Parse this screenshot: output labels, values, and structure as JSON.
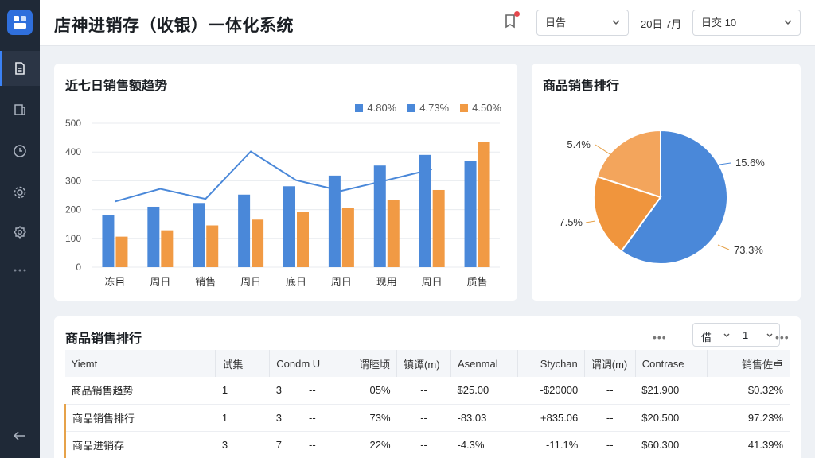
{
  "header": {
    "title": "店神进销存（收银）一体化系统",
    "select1": "日告",
    "date_label": "20日 7月",
    "select2": "日交 10"
  },
  "sidebar": {
    "items": [
      "document",
      "export",
      "history",
      "settings",
      "settings-alt",
      "more"
    ]
  },
  "trend_card": {
    "title": "近七日销售额趋势"
  },
  "pie_card": {
    "title": "商品销售排行"
  },
  "table_card": {
    "title": "商品销售排行",
    "pager_left": "借",
    "pager_num": "1",
    "columns": [
      "Yiemt",
      "试集",
      "Condm U",
      "谓睦顷",
      "镇谭(m)",
      "Asenmal",
      "Stychan",
      "谓调(m)",
      "Contrase",
      "销售佐卓"
    ],
    "rows": [
      [
        "商品销售趋势",
        "1",
        "3",
        "--",
        "05%",
        "--",
        "$25.00",
        "-$20000",
        "--",
        "$21.900",
        "$0.32%"
      ],
      [
        "商品销售排行",
        "1",
        "3",
        "--",
        "73%",
        "--",
        "-83.03",
        "+835.06",
        "--",
        "$20.500",
        "97.23%"
      ],
      [
        "商品进销存",
        "3",
        "7",
        "--",
        "22%",
        "--",
        "-4.3%",
        "-11.1%",
        "--",
        "$60.300",
        "41.39%"
      ]
    ]
  },
  "colors": {
    "blue": "#4a88d9",
    "orange": "#f19a44",
    "line": "#4a88d9"
  },
  "chart_data": [
    {
      "type": "bar",
      "title": "近七日销售额趋势",
      "categories": [
        "冻目",
        "周日",
        "销售",
        "周日",
        "底日",
        "周日",
        "现用",
        "周日",
        "质售"
      ],
      "ylim": [
        0,
        500
      ],
      "yticks": [
        0,
        100,
        200,
        300,
        400,
        500
      ],
      "grid": true,
      "legend_position": "top-right",
      "series": [
        {
          "name": "4.80%",
          "kind": "bar",
          "color": "#4a88d9",
          "values": [
            182,
            210,
            223,
            252,
            281,
            318,
            353,
            390,
            368
          ]
        },
        {
          "name": "4.73%",
          "kind": "line",
          "color": "#4a88d9",
          "values": [
            228,
            272,
            237,
            402,
            302,
            265,
            302,
            340,
            null
          ]
        },
        {
          "name": "4.50%",
          "kind": "bar",
          "color": "#f19a44",
          "values": [
            106,
            128,
            145,
            165,
            192,
            207,
            233,
            268,
            436
          ]
        }
      ]
    },
    {
      "type": "pie",
      "title": "商品销售排行",
      "slices": [
        {
          "label": "15.6%",
          "value": 60,
          "color": "#4a88d9"
        },
        {
          "label": "73.3%",
          "value": 20,
          "color": "#f0953d"
        },
        {
          "label": "7.5%",
          "value": 0,
          "color": "#f0953d"
        },
        {
          "label": "5.4%",
          "value": 20,
          "color": "#f3a55c"
        }
      ]
    }
  ]
}
